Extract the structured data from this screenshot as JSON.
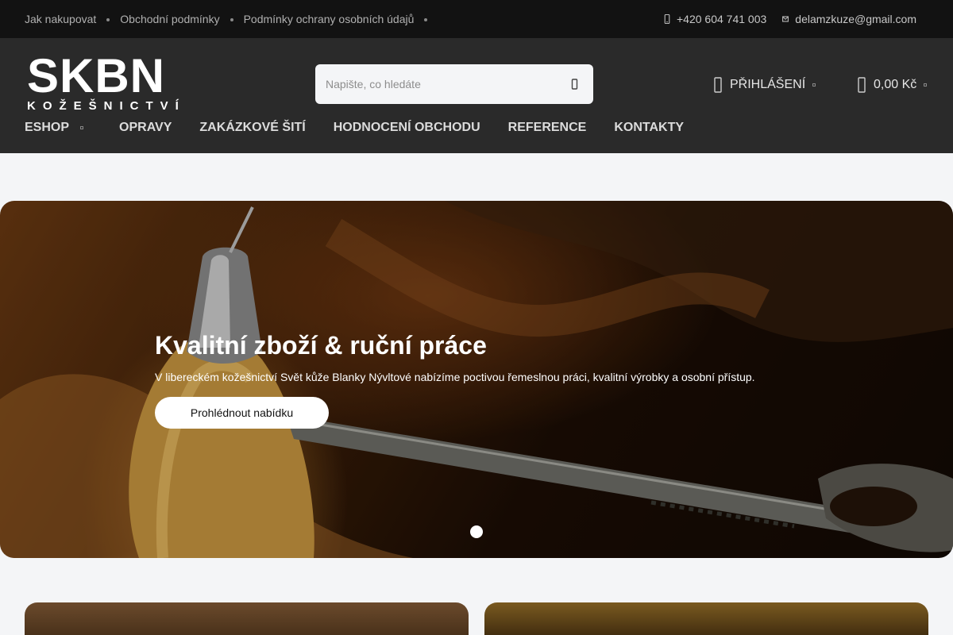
{
  "topbar": {
    "links": [
      "Jak nakupovat",
      "Obchodní podmínky",
      "Podmínky ochrany osobních údajů"
    ],
    "phone": "+420 604 741 003",
    "email": "delamzkuze@gmail.com"
  },
  "header": {
    "logo_main": "SKBN",
    "logo_sub": "KOŽEŠNICTVÍ",
    "search_placeholder": "Napište, co hledáte",
    "login_label": "PŘIHLÁŠENÍ",
    "cart_total": "0,00 Kč"
  },
  "nav": {
    "items": [
      "ESHOP",
      "OPRAVY",
      "ZAKÁZKOVÉ ŠITÍ",
      "HODNOCENÍ OBCHODU",
      "REFERENCE",
      "KONTAKTY"
    ]
  },
  "hero": {
    "title": "Kvalitní zboží & ruční práce",
    "description": "V libereckém kožešnictví Svět kůže Blanky Nývltové nabízíme poctivou řemeslnou práci, kvalitní výrobky a osobní přístup.",
    "cta_label": "Prohlédnout nabídku"
  },
  "icons": {
    "phone": "phone-icon",
    "email": "mail-icon",
    "search": "search-icon",
    "user": "user-icon",
    "cart": "cart-icon"
  },
  "colors": {
    "topbar_bg": "#121212",
    "header_bg": "#2a2a2a",
    "page_bg": "#f4f5f7"
  }
}
